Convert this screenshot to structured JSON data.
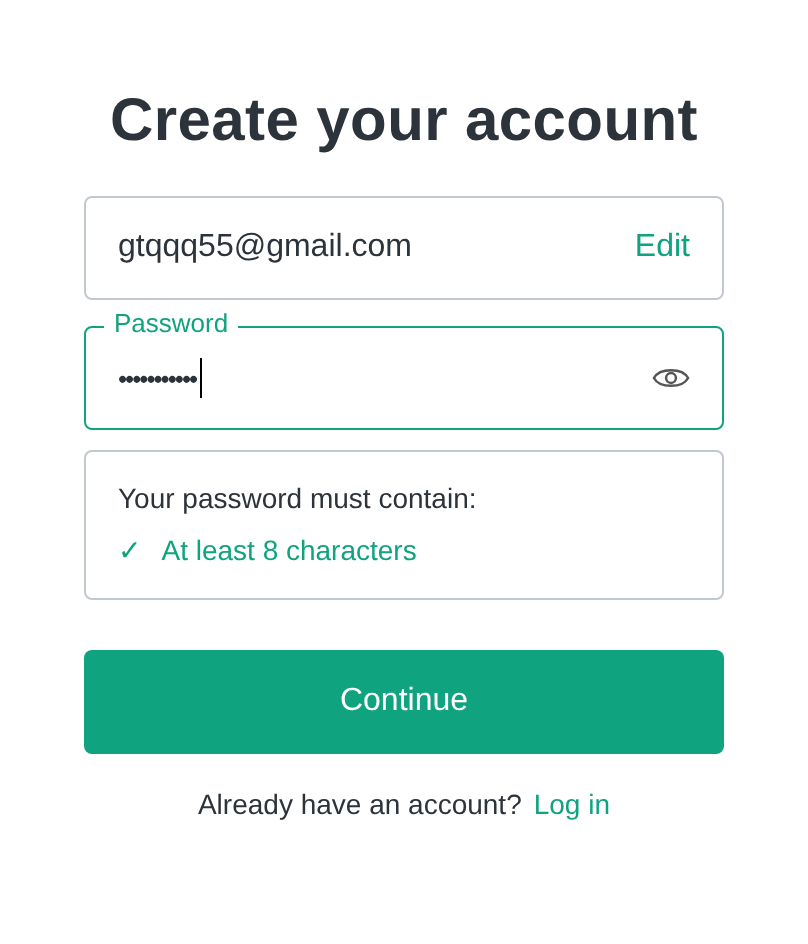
{
  "title": "Create your account",
  "email": {
    "value": "gtqqq55@gmail.com",
    "action": "Edit"
  },
  "password": {
    "label": "Password",
    "value": "•••••••••••",
    "focused": true
  },
  "requirements": {
    "heading": "Your password must contain:",
    "items": [
      {
        "mark": "✓",
        "text": "At least 8 characters",
        "met": true
      }
    ]
  },
  "continue_button": "Continue",
  "footer": {
    "text": "Already have an account?",
    "link": "Log in"
  }
}
